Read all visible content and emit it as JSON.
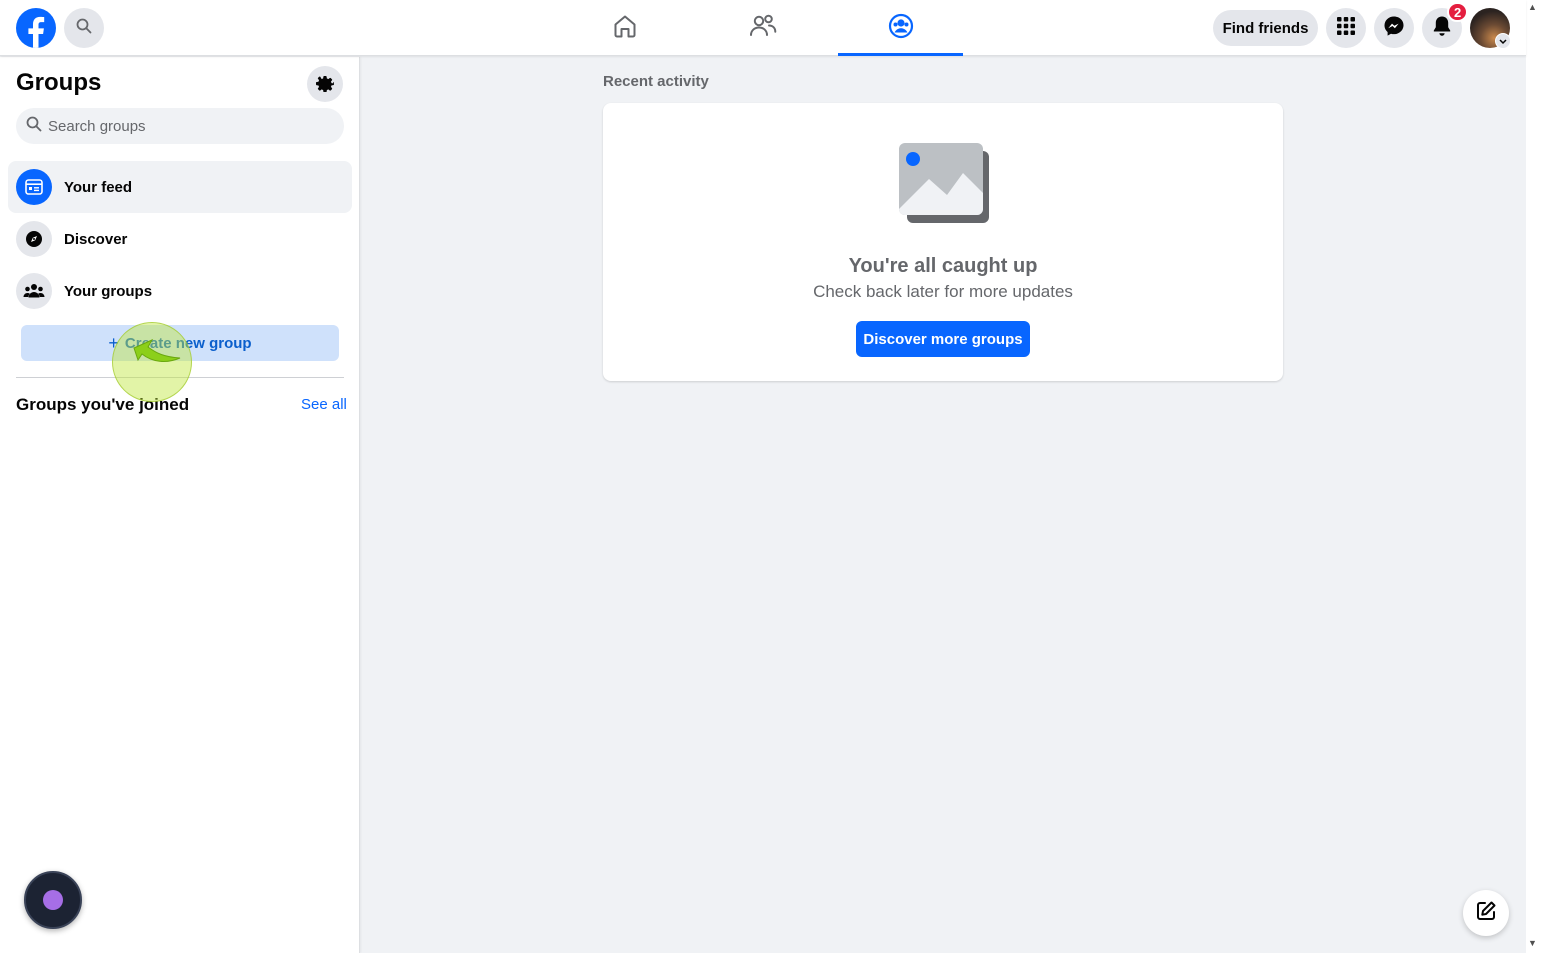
{
  "topbar": {
    "find_friends_label": "Find friends",
    "notification_count": "2",
    "nav_tabs": [
      "home",
      "friends",
      "groups"
    ],
    "active_tab": "groups"
  },
  "sidebar": {
    "title": "Groups",
    "search_placeholder": "Search groups",
    "items": [
      {
        "label": "Your feed",
        "icon": "feed-icon",
        "active": true
      },
      {
        "label": "Discover",
        "icon": "compass-icon",
        "active": false
      },
      {
        "label": "Your groups",
        "icon": "groups-icon",
        "active": false
      }
    ],
    "create_label": "Create new group",
    "create_plus": "+",
    "joined_title": "Groups you've joined",
    "see_all_label": "See all"
  },
  "main": {
    "section_label": "Recent activity",
    "empty_title": "You're all caught up",
    "empty_subtitle": "Check back later for more updates",
    "discover_button_label": "Discover more groups"
  },
  "colors": {
    "brand": "#0866ff",
    "badge": "#e41e3f",
    "cursor_highlight": "#bee63c"
  }
}
